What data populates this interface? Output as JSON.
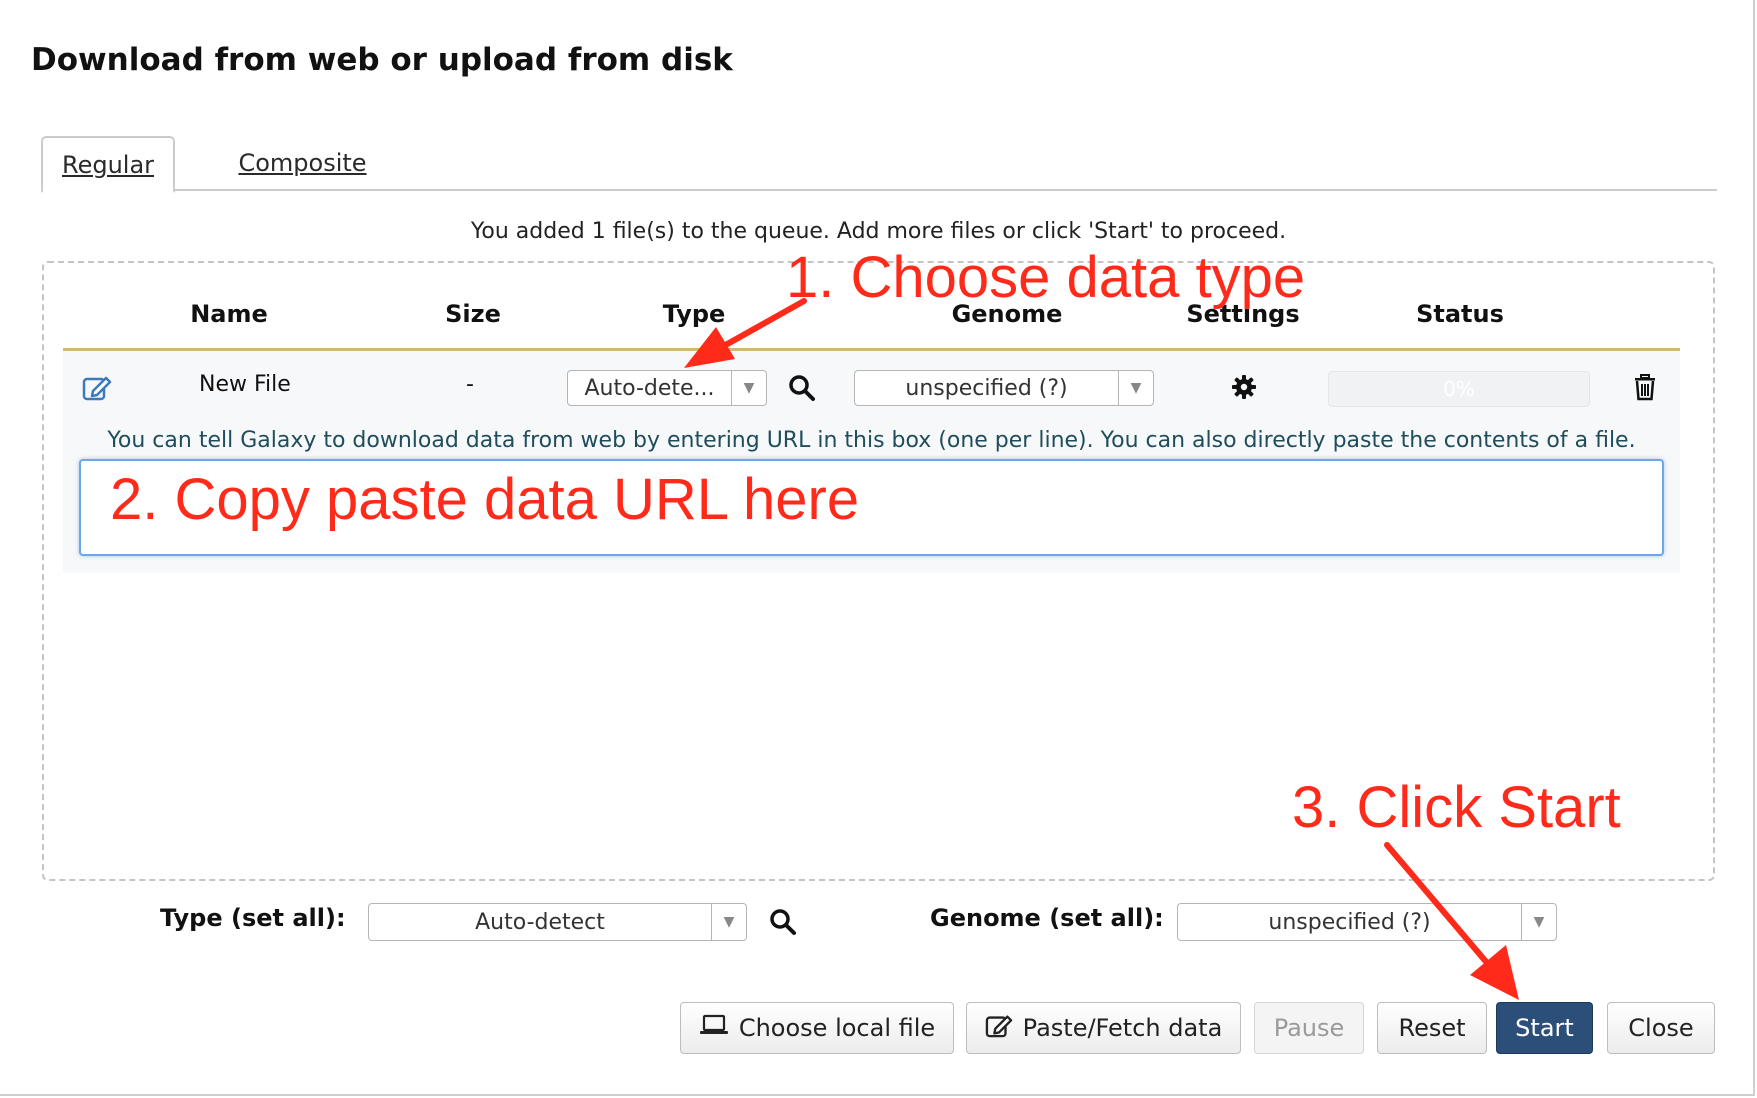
{
  "dialog": {
    "title": "Download from web or upload from disk"
  },
  "tabs": [
    {
      "label": "Regular",
      "active": true
    },
    {
      "label": "Composite",
      "active": false
    }
  ],
  "queue_message": "You added 1 file(s) to the queue. Add more files or click 'Start' to proceed.",
  "table": {
    "headers": {
      "name": "Name",
      "size": "Size",
      "type": "Type",
      "genome": "Genome",
      "settings": "Settings",
      "status": "Status"
    },
    "row": {
      "name": "New File",
      "size": "-",
      "type_value": "Auto-dete...",
      "genome_value": "unspecified (?)",
      "progress_label": "0%",
      "progress_percent": 0,
      "hint": "You can tell Galaxy to download data from web by entering URL in this box (one per line). You can also directly paste the contents of a file.",
      "url_value": ""
    }
  },
  "set_all": {
    "type_label": "Type (set all):",
    "type_value": "Auto-detect",
    "genome_label": "Genome (set all):",
    "genome_value": "unspecified (?)"
  },
  "buttons": {
    "choose_local": "Choose local file",
    "paste_fetch": "Paste/Fetch data",
    "pause": "Pause",
    "reset": "Reset",
    "start": "Start",
    "close": "Close"
  },
  "annotations": {
    "step1": "1. Choose data type",
    "step2": "2. Copy paste data URL here",
    "step3": "3. Click Start",
    "color": "#ff2a1a"
  },
  "colors": {
    "primary_button": "#2b4f78",
    "header_rule": "#d2b870",
    "hint_text": "#1f4d5c",
    "focus_border": "#6fa7e6"
  },
  "icons": {
    "edit": "edit-icon",
    "search": "search-icon",
    "settings": "gear-icon",
    "delete": "trash-icon",
    "laptop": "laptop-icon",
    "paste": "edit-icon"
  }
}
